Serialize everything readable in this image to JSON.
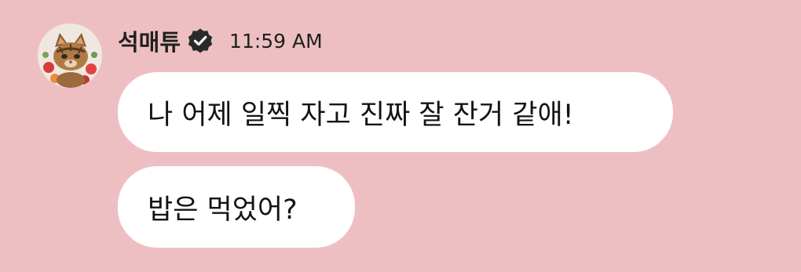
{
  "message_group": {
    "sender": {
      "name": "석매튜",
      "verified": true,
      "timestamp": "11:59 AM",
      "avatar": "tabby-cat-avatar"
    },
    "messages": [
      {
        "text": "나 어제 일찍 자고 진짜 잘 잔거 같애!"
      },
      {
        "text": "밥은 먹었어?"
      }
    ]
  },
  "colors": {
    "background": "#eebfc2",
    "bubble": "#ffffff",
    "text": "#141414",
    "badge": "#2a2a2a"
  },
  "icons": {
    "verified": "verified-badge-icon"
  }
}
